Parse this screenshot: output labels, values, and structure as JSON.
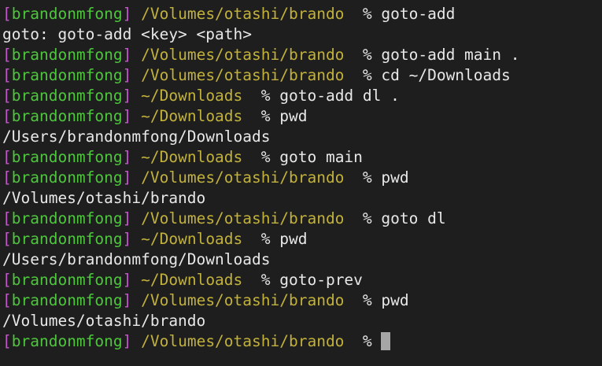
{
  "colors": {
    "background": "#1e1e1e",
    "bracket": "#c157c9",
    "user": "#4ec63d",
    "path": "#c2b13b",
    "text": "#e8e8e8",
    "cursor": "#a6a6a6"
  },
  "lines": [
    {
      "type": "prompt",
      "user": "brandonmfong",
      "path": "/Volumes/otashi/brando",
      "command": "goto-add"
    },
    {
      "type": "output",
      "text": "goto: goto-add <key> <path>"
    },
    {
      "type": "prompt",
      "user": "brandonmfong",
      "path": "/Volumes/otashi/brando",
      "command": "goto-add main ."
    },
    {
      "type": "prompt",
      "user": "brandonmfong",
      "path": "/Volumes/otashi/brando",
      "command": "cd ~/Downloads"
    },
    {
      "type": "prompt",
      "user": "brandonmfong",
      "path": "~/Downloads",
      "command": "goto-add dl ."
    },
    {
      "type": "prompt",
      "user": "brandonmfong",
      "path": "~/Downloads",
      "command": "pwd"
    },
    {
      "type": "output",
      "text": "/Users/brandonmfong/Downloads"
    },
    {
      "type": "prompt",
      "user": "brandonmfong",
      "path": "~/Downloads",
      "command": "goto main"
    },
    {
      "type": "prompt",
      "user": "brandonmfong",
      "path": "/Volumes/otashi/brando",
      "command": "pwd"
    },
    {
      "type": "output",
      "text": "/Volumes/otashi/brando"
    },
    {
      "type": "prompt",
      "user": "brandonmfong",
      "path": "/Volumes/otashi/brando",
      "command": "goto dl"
    },
    {
      "type": "prompt",
      "user": "brandonmfong",
      "path": "~/Downloads",
      "command": "pwd"
    },
    {
      "type": "output",
      "text": "/Users/brandonmfong/Downloads"
    },
    {
      "type": "prompt",
      "user": "brandonmfong",
      "path": "~/Downloads",
      "command": "goto-prev"
    },
    {
      "type": "prompt",
      "user": "brandonmfong",
      "path": "/Volumes/otashi/brando",
      "command": "pwd"
    },
    {
      "type": "output",
      "text": "/Volumes/otashi/brando"
    },
    {
      "type": "prompt",
      "user": "brandonmfong",
      "path": "/Volumes/otashi/brando",
      "command": "",
      "cursor": true
    }
  ]
}
